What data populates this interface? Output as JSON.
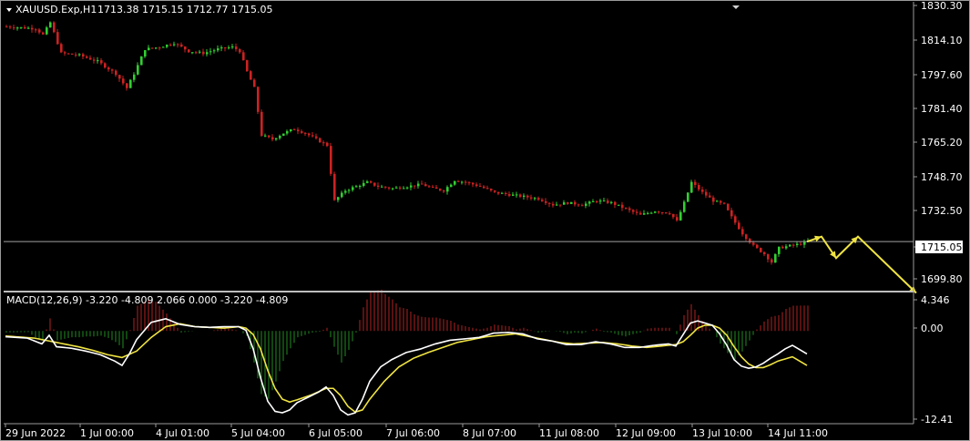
{
  "header": {
    "symbol_label": "XAUUSD.Exp,H1",
    "ohlc_label": "1713.38 1715.15 1712.77 1715.05"
  },
  "macd_header": {
    "label": "MACD(12,26,9) -3.220 -4.809 2.066 0.000 -3.220 -4.809"
  },
  "colors": {
    "background": "#000000",
    "bull_candle": "#32cd32",
    "bear_candle": "#cc2222",
    "hist_positive": "#b22222",
    "hist_negative": "#228b22",
    "macd_line": "#ffffff",
    "signal_line": "#f0e442",
    "forecast_arrow": "#f0e442",
    "price_line": "#a0a0a0"
  },
  "chart_data": [
    {
      "type": "candlestick",
      "symbol": "XAUUSD.Exp",
      "timeframe": "H1",
      "current_price": 1715.05,
      "ylim": [
        1692.0,
        1830.3
      ],
      "y_ticks": [
        "1830.30",
        "1814.10",
        "1797.60",
        "1781.40",
        "1765.20",
        "1748.70",
        "1732.50",
        "1715.05",
        "1699.80"
      ],
      "x_ticks": [
        "29 Jun 2022",
        "1 Jul 00:00",
        "4 Jul 01:00",
        "5 Jul 04:00",
        "6 Jul 05:00",
        "7 Jul 06:00",
        "8 Jul 07:00",
        "11 Jul 08:00",
        "12 Jul 09:00",
        "13 Jul 10:00",
        "14 Jul 11:00"
      ],
      "price_path": [
        [
          0,
          1820
        ],
        [
          8,
          1819
        ],
        [
          10,
          1816
        ],
        [
          12,
          1822
        ],
        [
          15,
          1807
        ],
        [
          20,
          1806
        ],
        [
          25,
          1803
        ],
        [
          30,
          1797
        ],
        [
          33,
          1790
        ],
        [
          35,
          1797
        ],
        [
          38,
          1809
        ],
        [
          42,
          1810
        ],
        [
          46,
          1812
        ],
        [
          50,
          1808
        ],
        [
          54,
          1807
        ],
        [
          58,
          1809
        ],
        [
          62,
          1810
        ],
        [
          64,
          1808
        ],
        [
          66,
          1798
        ],
        [
          68,
          1790
        ],
        [
          70,
          1767
        ],
        [
          73,
          1765
        ],
        [
          76,
          1768
        ],
        [
          79,
          1770
        ],
        [
          82,
          1768
        ],
        [
          85,
          1765
        ],
        [
          88,
          1762
        ],
        [
          90,
          1735
        ],
        [
          93,
          1740
        ],
        [
          96,
          1742
        ],
        [
          99,
          1744
        ],
        [
          102,
          1742
        ],
        [
          106,
          1741
        ],
        [
          110,
          1742
        ],
        [
          114,
          1743
        ],
        [
          117,
          1741
        ],
        [
          120,
          1740
        ],
        [
          123,
          1745
        ],
        [
          126,
          1744
        ],
        [
          130,
          1742
        ],
        [
          134,
          1739
        ],
        [
          138,
          1738
        ],
        [
          142,
          1737
        ],
        [
          146,
          1736
        ],
        [
          150,
          1733
        ],
        [
          154,
          1734
        ],
        [
          158,
          1733
        ],
        [
          162,
          1735
        ],
        [
          166,
          1734
        ],
        [
          170,
          1731
        ],
        [
          174,
          1728
        ],
        [
          178,
          1730
        ],
        [
          182,
          1729
        ],
        [
          184,
          1725
        ],
        [
          186,
          1734
        ],
        [
          188,
          1744
        ],
        [
          191,
          1739
        ],
        [
          194,
          1735
        ],
        [
          197,
          1733
        ],
        [
          199,
          1727
        ],
        [
          202,
          1719
        ],
        [
          205,
          1713
        ],
        [
          208,
          1709
        ],
        [
          210,
          1705
        ],
        [
          212,
          1712
        ],
        [
          215,
          1713
        ],
        [
          218,
          1714
        ],
        [
          220,
          1715.05
        ]
      ],
      "forecast_path": [
        [
          220,
          1715.05
        ],
        [
          224,
          1717.5
        ],
        [
          228,
          1707
        ],
        [
          234,
          1717.5
        ],
        [
          250,
          1690
        ]
      ]
    },
    {
      "type": "macd",
      "params": "MACD(12,26,9)",
      "ylim": [
        -12.41,
        4.346
      ],
      "y_ticks": [
        "4.346",
        "0.00",
        "-12.41"
      ],
      "macd": [
        [
          0,
          -0.8
        ],
        [
          6,
          -1.0
        ],
        [
          10,
          -1.8
        ],
        [
          12,
          -0.6
        ],
        [
          14,
          -2.2
        ],
        [
          18,
          -2.4
        ],
        [
          22,
          -2.8
        ],
        [
          26,
          -3.3
        ],
        [
          30,
          -4.2
        ],
        [
          32,
          -4.8
        ],
        [
          34,
          -3.2
        ],
        [
          36,
          -1.2
        ],
        [
          40,
          1.2
        ],
        [
          44,
          1.7
        ],
        [
          48,
          0.9
        ],
        [
          52,
          0.6
        ],
        [
          56,
          0.5
        ],
        [
          60,
          0.6
        ],
        [
          64,
          0.6
        ],
        [
          66,
          0.1
        ],
        [
          68,
          -2.5
        ],
        [
          70,
          -6.5
        ],
        [
          72,
          -9.8
        ],
        [
          74,
          -11.2
        ],
        [
          76,
          -11.4
        ],
        [
          78,
          -11.0
        ],
        [
          80,
          -10.0
        ],
        [
          84,
          -9.0
        ],
        [
          86,
          -8.5
        ],
        [
          88,
          -7.8
        ],
        [
          90,
          -9.0
        ],
        [
          92,
          -11.0
        ],
        [
          94,
          -11.7
        ],
        [
          96,
          -11.4
        ],
        [
          98,
          -9.5
        ],
        [
          100,
          -7.0
        ],
        [
          103,
          -5.0
        ],
        [
          106,
          -4.0
        ],
        [
          110,
          -3.0
        ],
        [
          114,
          -2.5
        ],
        [
          118,
          -1.8
        ],
        [
          122,
          -1.3
        ],
        [
          126,
          -1.1
        ],
        [
          130,
          -0.9
        ],
        [
          134,
          -0.3
        ],
        [
          138,
          -0.2
        ],
        [
          142,
          -0.4
        ],
        [
          146,
          -1.1
        ],
        [
          150,
          -1.4
        ],
        [
          154,
          -1.9
        ],
        [
          158,
          -1.9
        ],
        [
          162,
          -1.5
        ],
        [
          166,
          -1.8
        ],
        [
          170,
          -2.3
        ],
        [
          174,
          -2.3
        ],
        [
          178,
          -2.0
        ],
        [
          182,
          -1.8
        ],
        [
          184,
          -2.1
        ],
        [
          186,
          -0.5
        ],
        [
          188,
          1.1
        ],
        [
          190,
          1.4
        ],
        [
          192,
          1.1
        ],
        [
          194,
          0.8
        ],
        [
          196,
          -0.4
        ],
        [
          198,
          -2.0
        ],
        [
          200,
          -4.0
        ],
        [
          202,
          -4.9
        ],
        [
          204,
          -5.2
        ],
        [
          206,
          -5.0
        ],
        [
          208,
          -4.5
        ],
        [
          210,
          -3.8
        ],
        [
          212,
          -3.2
        ],
        [
          214,
          -2.5
        ],
        [
          216,
          -2.0
        ],
        [
          220,
          -3.2
        ]
      ],
      "signal": [
        [
          0,
          -0.7
        ],
        [
          8,
          -1.0
        ],
        [
          12,
          -1.4
        ],
        [
          16,
          -1.8
        ],
        [
          20,
          -2.2
        ],
        [
          24,
          -2.7
        ],
        [
          28,
          -3.3
        ],
        [
          32,
          -3.7
        ],
        [
          36,
          -2.8
        ],
        [
          40,
          -0.9
        ],
        [
          44,
          0.6
        ],
        [
          48,
          1.0
        ],
        [
          52,
          0.6
        ],
        [
          56,
          0.5
        ],
        [
          60,
          0.4
        ],
        [
          64,
          0.6
        ],
        [
          66,
          0.4
        ],
        [
          68,
          -0.5
        ],
        [
          70,
          -2.5
        ],
        [
          72,
          -5.5
        ],
        [
          74,
          -8.0
        ],
        [
          76,
          -9.5
        ],
        [
          78,
          -9.9
        ],
        [
          80,
          -9.6
        ],
        [
          84,
          -8.9
        ],
        [
          88,
          -8.0
        ],
        [
          90,
          -8.0
        ],
        [
          92,
          -9.0
        ],
        [
          94,
          -10.5
        ],
        [
          96,
          -11.3
        ],
        [
          98,
          -11.0
        ],
        [
          100,
          -9.5
        ],
        [
          104,
          -7.0
        ],
        [
          108,
          -5.0
        ],
        [
          112,
          -3.8
        ],
        [
          116,
          -3.0
        ],
        [
          120,
          -2.3
        ],
        [
          124,
          -1.6
        ],
        [
          128,
          -1.2
        ],
        [
          132,
          -0.8
        ],
        [
          136,
          -0.6
        ],
        [
          140,
          -0.4
        ],
        [
          144,
          -0.8
        ],
        [
          148,
          -1.2
        ],
        [
          152,
          -1.6
        ],
        [
          156,
          -1.8
        ],
        [
          160,
          -1.7
        ],
        [
          164,
          -1.6
        ],
        [
          168,
          -1.8
        ],
        [
          172,
          -2.1
        ],
        [
          176,
          -2.3
        ],
        [
          180,
          -2.1
        ],
        [
          184,
          -1.9
        ],
        [
          186,
          -1.5
        ],
        [
          188,
          -0.6
        ],
        [
          190,
          0.4
        ],
        [
          192,
          0.8
        ],
        [
          194,
          0.8
        ],
        [
          196,
          0.4
        ],
        [
          198,
          -0.6
        ],
        [
          200,
          -2.2
        ],
        [
          202,
          -3.6
        ],
        [
          204,
          -4.6
        ],
        [
          206,
          -5.1
        ],
        [
          208,
          -5.1
        ],
        [
          210,
          -4.7
        ],
        [
          212,
          -4.2
        ],
        [
          216,
          -3.6
        ],
        [
          220,
          -4.809
        ]
      ]
    }
  ]
}
